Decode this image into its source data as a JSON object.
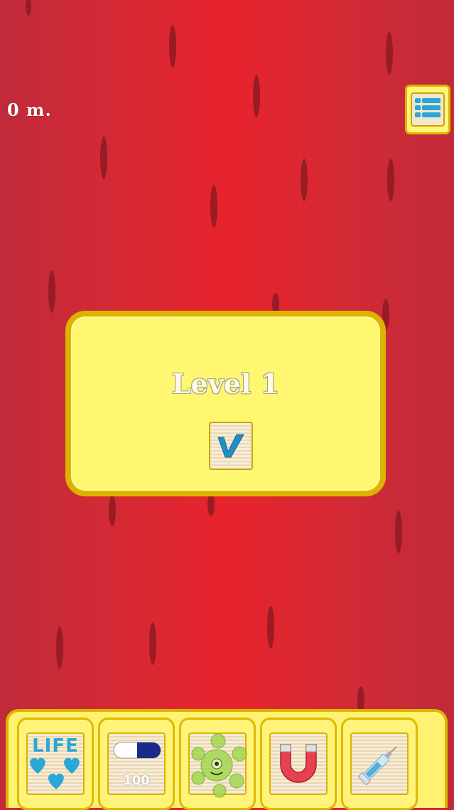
{
  "hud": {
    "distance": "0 m."
  },
  "dialog": {
    "title": "Level 1"
  },
  "powerups": {
    "life": {
      "label": "LIFE"
    },
    "pill": {
      "label": "100"
    }
  },
  "colors": {
    "background": "#e8232d",
    "panel": "#fff770",
    "panel_border": "#dcb400",
    "icon_blue": "#2aa7d6"
  },
  "icons": {
    "menu": "list-menu-icon",
    "confirm": "checkmark-icon",
    "life": "hearts-icon",
    "pill": "pill-icon",
    "virus": "green-virus-icon",
    "magnet": "magnet-icon",
    "syringe": "syringe-icon"
  }
}
